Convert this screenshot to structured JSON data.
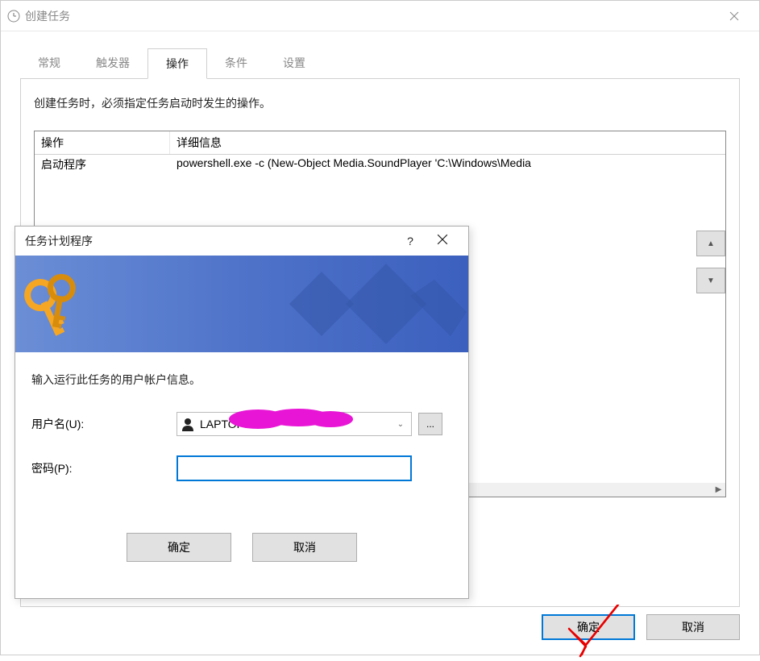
{
  "main": {
    "title": "创建任务",
    "tabs": [
      {
        "label": "常规",
        "active": false
      },
      {
        "label": "触发器",
        "active": false
      },
      {
        "label": "操作",
        "active": true
      },
      {
        "label": "条件",
        "active": false
      },
      {
        "label": "设置",
        "active": false
      }
    ],
    "description": "创建任务时，必须指定任务启动时发生的操作。",
    "table": {
      "header_action": "操作",
      "header_details": "详细信息",
      "row_action": "启动程序",
      "row_details": "powershell.exe -c (New-Object Media.SoundPlayer 'C:\\Windows\\Media"
    },
    "ok_label": "确定",
    "cancel_label": "取消"
  },
  "cred": {
    "title": "任务计划程序",
    "help": "?",
    "instruction": "输入运行此任务的用户帐户信息。",
    "username_label": "用户名(U):",
    "username_value": "LAPTOP-",
    "password_label": "密码(P):",
    "browse_label": "...",
    "ok_label": "确定",
    "cancel_label": "取消"
  }
}
